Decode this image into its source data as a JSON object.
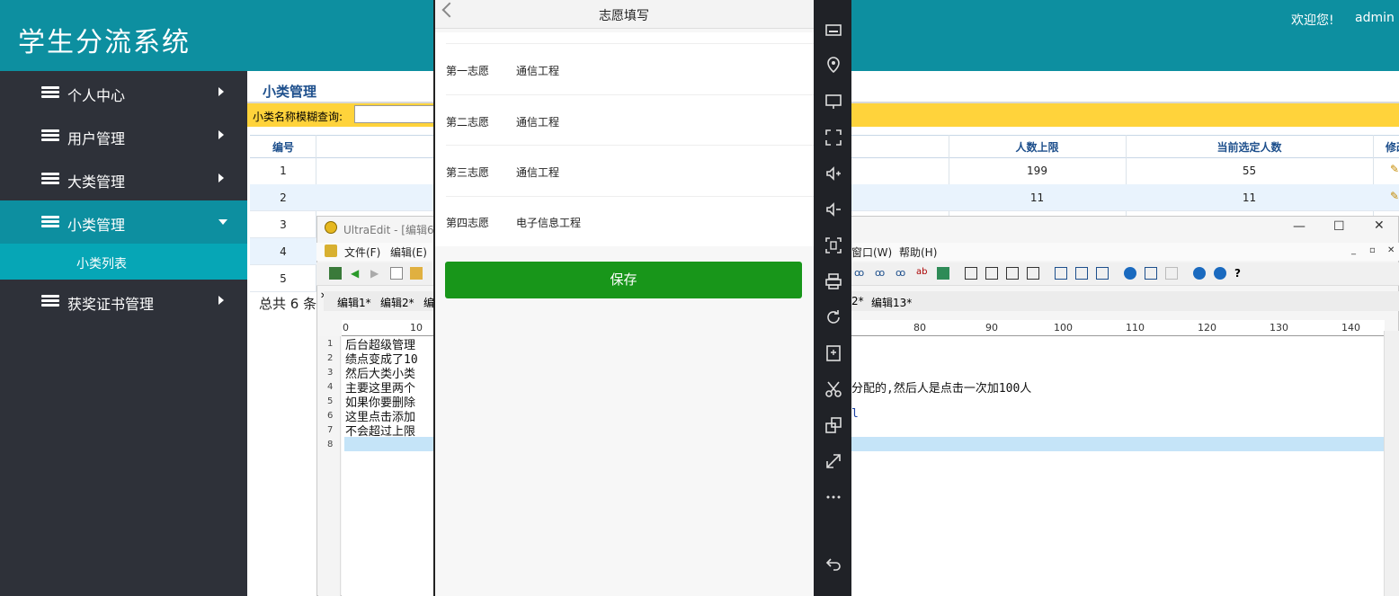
{
  "header": {
    "title": "学生分流系统",
    "welcome": "欢迎您!",
    "user": "admin"
  },
  "sidebar": {
    "items": [
      {
        "label": "个人中心"
      },
      {
        "label": "用户管理"
      },
      {
        "label": "大类管理"
      },
      {
        "label": "小类管理",
        "expanded": true
      },
      {
        "label": "获奖证书管理"
      }
    ],
    "sub_item": "小类列表"
  },
  "main": {
    "section_title": "小类管理",
    "search_label": "小类名称模糊查询:",
    "columns": [
      "编号",
      "人数上限",
      "当前选定人数",
      "修改"
    ],
    "rows": [
      {
        "id": "1",
        "limit": "199",
        "current": "55"
      },
      {
        "id": "2",
        "limit": "11",
        "current": "11"
      },
      {
        "id": "3"
      },
      {
        "id": "4"
      },
      {
        "id": "5"
      }
    ],
    "total_text": "总共 6 条"
  },
  "ultraedit": {
    "title": "UltraEdit - [编辑6",
    "menus": [
      "文件(F)",
      "编辑(E)",
      "窗口(W)",
      "帮助(H)"
    ],
    "tabs": [
      "编辑1*",
      "编辑2*",
      "编",
      "2*",
      "编辑13*"
    ],
    "ruler": [
      "0",
      "10",
      "80",
      "90",
      "100",
      "110",
      "120",
      "130",
      "140"
    ],
    "line_numbers": [
      "1",
      "2",
      "3",
      "4",
      "5",
      "6",
      "7",
      "8"
    ],
    "lines": [
      "后台超级管理",
      "绩点变成了10",
      "然后大类小类",
      "主要这里两个",
      "如果你要删除",
      "这里点击添加",
      "不会超过上限",
      ""
    ],
    "right_text_1": "分配的,然后人是点击一次加100人",
    "right_text_2": "l"
  },
  "phone": {
    "title": "志愿填写",
    "choices": [
      {
        "label": "第一志愿",
        "value": "通信工程"
      },
      {
        "label": "第二志愿",
        "value": "通信工程"
      },
      {
        "label": "第三志愿",
        "value": "通信工程"
      },
      {
        "label": "第四志愿",
        "value": "电子信息工程"
      }
    ],
    "save_label": "保存",
    "save_color": "#18961a"
  },
  "emulator": {
    "icons": [
      "keyboard-icon",
      "location-icon",
      "screen-icon",
      "fullscreen-icon",
      "volume-up-icon",
      "volume-down-icon",
      "screenshot-icon",
      "print-icon",
      "rotate-icon",
      "resolution-icon",
      "cut-icon",
      "multi-window-icon",
      "resize-icon",
      "more-icon",
      "back-icon"
    ]
  },
  "colors": {
    "header": "#0d8fa0",
    "sidebar": "#2e3139",
    "search_bar": "#ffd33b"
  }
}
